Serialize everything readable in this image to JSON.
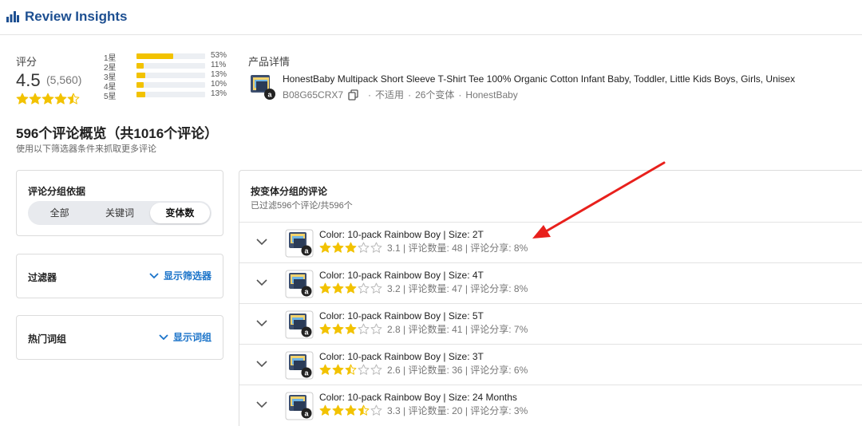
{
  "app": {
    "title": "Review Insights",
    "icon": "bar-chart-icon",
    "accent": "#1d4f91"
  },
  "rating": {
    "label": "评分",
    "value": "4.5",
    "count": "(5,560)",
    "stars": 4.5,
    "distribution": [
      {
        "label": "1星",
        "percent": 53,
        "pct_text": "53%"
      },
      {
        "label": "2星",
        "percent": 11,
        "pct_text": "11%"
      },
      {
        "label": "3星",
        "percent": 13,
        "pct_text": "13%"
      },
      {
        "label": "4星",
        "percent": 10,
        "pct_text": "10%"
      },
      {
        "label": "5星",
        "percent": 13,
        "pct_text": "13%"
      }
    ]
  },
  "product": {
    "section_label": "产品详情",
    "title": "HonestBaby Multipack Short Sleeve T-Shirt Tee 100% Organic Cotton Infant Baby, Toddler, Little Kids Boys, Girls, Unisex",
    "asin": "B08G65CRX7",
    "meta_1": "不适用",
    "meta_2": "26个变体",
    "brand": "HonestBaby"
  },
  "overview": {
    "title": "596个评论概览（共1016个评论）",
    "subtitle": "使用以下筛选器条件来抓取更多评论"
  },
  "grouping": {
    "title": "评论分组依据",
    "options": [
      "全部",
      "关键词",
      "变体数"
    ],
    "selected": "变体数"
  },
  "filter": {
    "title": "过滤器",
    "link": "显示筛选器"
  },
  "hot_words": {
    "title": "热门词组",
    "link": "显示词组"
  },
  "variants": {
    "title": "按变体分组的评论",
    "subtitle": "已过滤596个评论/共596个",
    "items": [
      {
        "name": "Color: 10-pack Rainbow Boy | Size: 2T",
        "rating": 3.1,
        "stats": "3.1 | 评论数量: 48 | 评论分享: 8%"
      },
      {
        "name": "Color: 10-pack Rainbow Boy | Size: 4T",
        "rating": 3.2,
        "stats": "3.2 | 评论数量: 47 | 评论分享: 8%"
      },
      {
        "name": "Color: 10-pack Rainbow Boy | Size: 5T",
        "rating": 2.8,
        "stats": "2.8 | 评论数量: 41 | 评论分享: 7%"
      },
      {
        "name": "Color: 10-pack Rainbow Boy | Size: 3T",
        "rating": 2.6,
        "stats": "2.6 | 评论数量: 36 | 评论分享: 6%"
      },
      {
        "name": "Color: 10-pack Rainbow Boy | Size: 24 Months",
        "rating": 3.3,
        "stats": "3.3 | 评论数量: 20 | 评论分享: 3%"
      }
    ]
  },
  "colors": {
    "star": "#f2c200",
    "link": "#1a73c9",
    "annotation_arrow": "#e8201c"
  }
}
